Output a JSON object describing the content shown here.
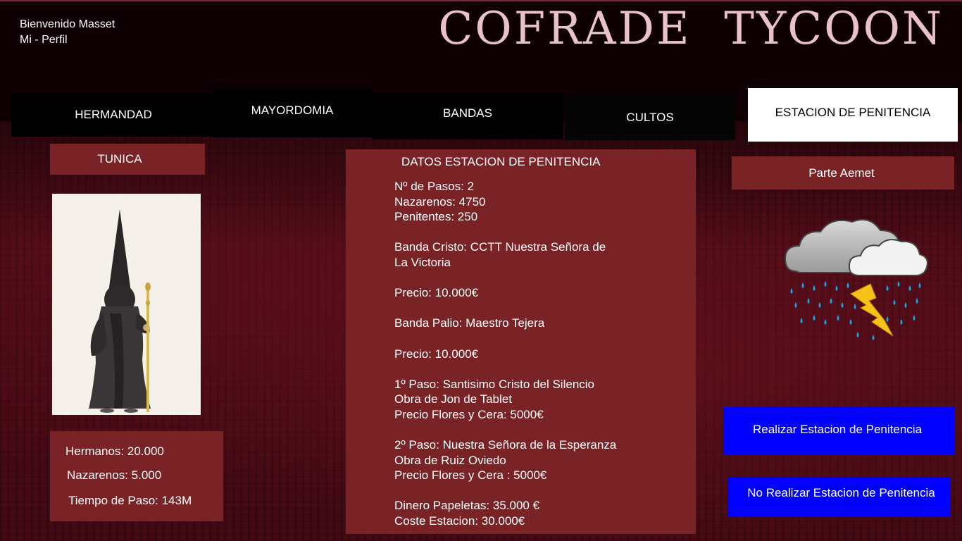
{
  "header": {
    "welcome": "Bienvenido Masset",
    "profile_link": "Mi - Perfil",
    "title": "COFRADE  TYCOON"
  },
  "nav": {
    "tabs": [
      {
        "label": "HERMANDAD",
        "active": false
      },
      {
        "label": "MAYORDOMIA",
        "active": false
      },
      {
        "label": "BANDAS",
        "active": false
      },
      {
        "label": "CULTOS",
        "active": false
      },
      {
        "label": "ESTACION DE PENITENCIA",
        "active": true
      }
    ]
  },
  "tunica": {
    "label": "TUNICA",
    "image_icon": "nazareno-icon"
  },
  "stats": {
    "hermanos": "Hermanos: 20.000",
    "nazarenos": "Nazarenos: 5.000",
    "tiempo_paso": "Tiempo de Paso: 143M"
  },
  "datos": {
    "title": "DATOS ESTACION DE PENITENCIA",
    "lines": [
      "Nº de Pasos: 2",
      "Nazarenos: 4750",
      "Penitentes: 250",
      "",
      "Banda Cristo: CCTT Nuestra Señora de",
      "La Victoria",
      "",
      "Precio: 10.000€",
      "",
      "Banda Palio: Maestro Tejera",
      "",
      "Precio: 10.000€",
      "",
      "1º Paso: Santisimo Cristo del Silencio",
      "Obra de Jon de Tablet",
      "Precio Flores y Cera: 5000€",
      "",
      "2º Paso: Nuestra Señora de la Esperanza",
      "Obra de Ruiz Oviedo",
      "Precio Flores y Cera : 5000€",
      "",
      "Dinero Papeletas: 35.000 €",
      "Coste Estacion: 30.000€"
    ]
  },
  "weather": {
    "label": "Parte Aemet",
    "icon": "storm-icon"
  },
  "actions": {
    "realizar": "Realizar Estacion de Penitencia",
    "no_realizar": "No Realizar Estacion de Penitencia"
  },
  "colors": {
    "panel": "#7a2326",
    "header_bg": "#0e0003",
    "title": "#e9c2c9",
    "button": "#0000ff"
  }
}
